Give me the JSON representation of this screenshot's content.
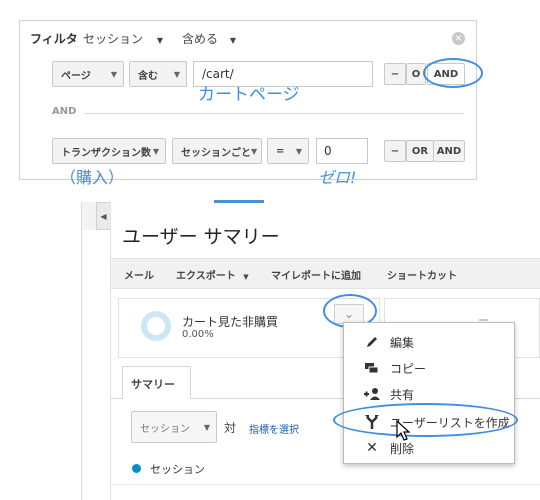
{
  "filter_panel": {
    "title": "フィルタ",
    "scope": "セッション",
    "mode": "含める",
    "row1": {
      "dimension": "ページ",
      "condition": "含む",
      "value": "/cart/",
      "minus": "−",
      "or_label": "O",
      "and_label": "AND"
    },
    "and_divider": "AND",
    "row2": {
      "metric": "トランザクション数",
      "scope": "セッションごと",
      "operator": "=",
      "value": "0",
      "minus": "−",
      "or_label": "OR",
      "and_label": "AND"
    }
  },
  "annotations": {
    "cart_page": "カートページ",
    "purchase": "（購入）",
    "zero": "ゼロ!"
  },
  "report": {
    "title": "ユーザー サマリー",
    "toolbar": [
      "メール",
      "エクスポート",
      "マイレポートに追加",
      "ショートカット"
    ],
    "segment": {
      "name": "カート見た非購買",
      "percent": "0.00%",
      "partial": "ー"
    },
    "tab": "サマリー",
    "metric_select": "セッション",
    "vs": "対",
    "choose_metric": "指標を選択",
    "legend": "セッション"
  },
  "dropdown_menu": {
    "items": [
      "編集",
      "コピー",
      "共有",
      "ユーザーリストを作成",
      "削除"
    ]
  },
  "colors": {
    "highlight": "#3f8fe0",
    "legend_dot": "#058dc7",
    "donut": "#cfe6f5"
  }
}
